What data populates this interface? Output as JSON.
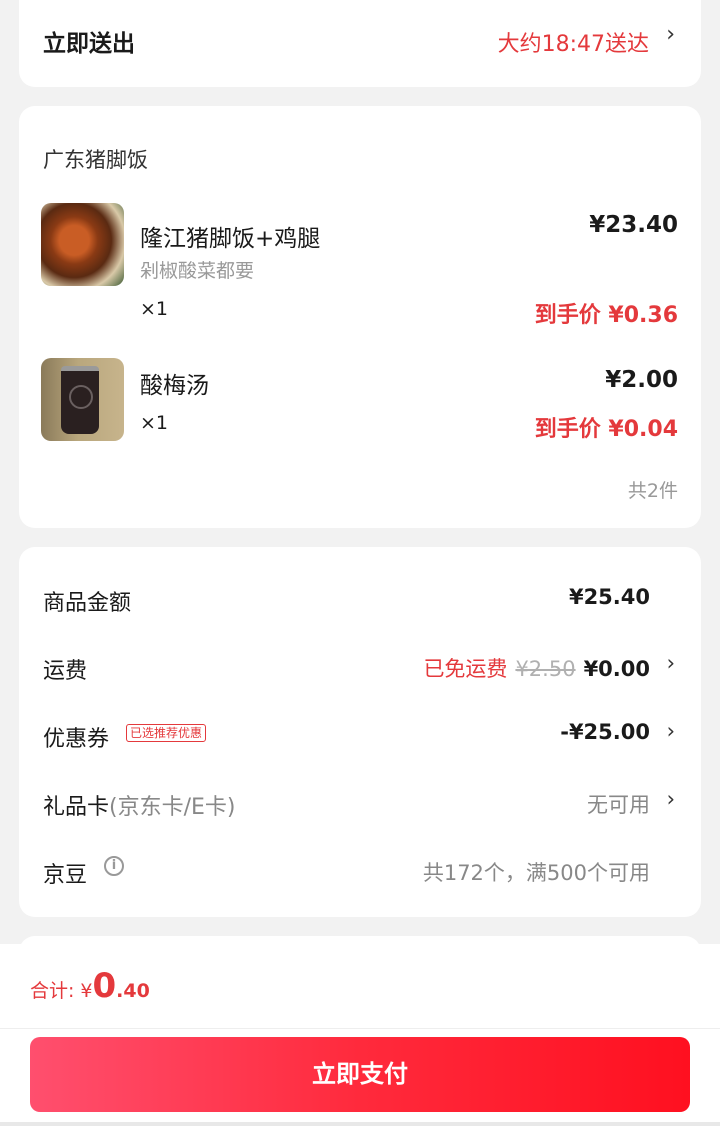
{
  "delivery": {
    "label": "立即送出",
    "time_text": "大约18:47送达",
    "chevron": "›"
  },
  "shop": {
    "name": "广东猪脚饭",
    "items": [
      {
        "name": "隆江猪脚饭+鸡腿",
        "spec": "剁椒酸菜都要",
        "qty": "×1",
        "price": "¥23.40",
        "final_price": "到手价 ¥0.36",
        "image_icon": "pork-knuckle-rice-photo"
      },
      {
        "name": "酸梅汤",
        "spec": "",
        "qty": "×1",
        "price": "¥2.00",
        "final_price": "到手价 ¥0.04",
        "image_icon": "sour-plum-drink-photo"
      }
    ],
    "count_text": "共2件"
  },
  "prices": {
    "goods_label": "商品金额",
    "goods_value": "¥25.40",
    "shipping_label": "运费",
    "shipping_free_text": "已免运费",
    "shipping_original": "¥2.50",
    "shipping_value": "¥0.00",
    "coupon_label": "优惠券",
    "coupon_badge": "已选推荐优惠",
    "coupon_value": "-¥25.00",
    "giftcard_label": "礼品卡",
    "giftcard_sub": "(京东卡/E卡)",
    "giftcard_value": "无可用",
    "jingdou_label": "京豆",
    "jingdou_value": "共172个，满500个可用",
    "chevron": "›"
  },
  "footer": {
    "total_label": "合计:",
    "currency": "¥",
    "total_int": "0",
    "total_dec": ".40",
    "pay_button": "立即支付"
  },
  "colors": {
    "accent_red": "#e4393c",
    "pay_gradient_start": "#ff4f6e",
    "pay_gradient_end": "#ff1020"
  }
}
